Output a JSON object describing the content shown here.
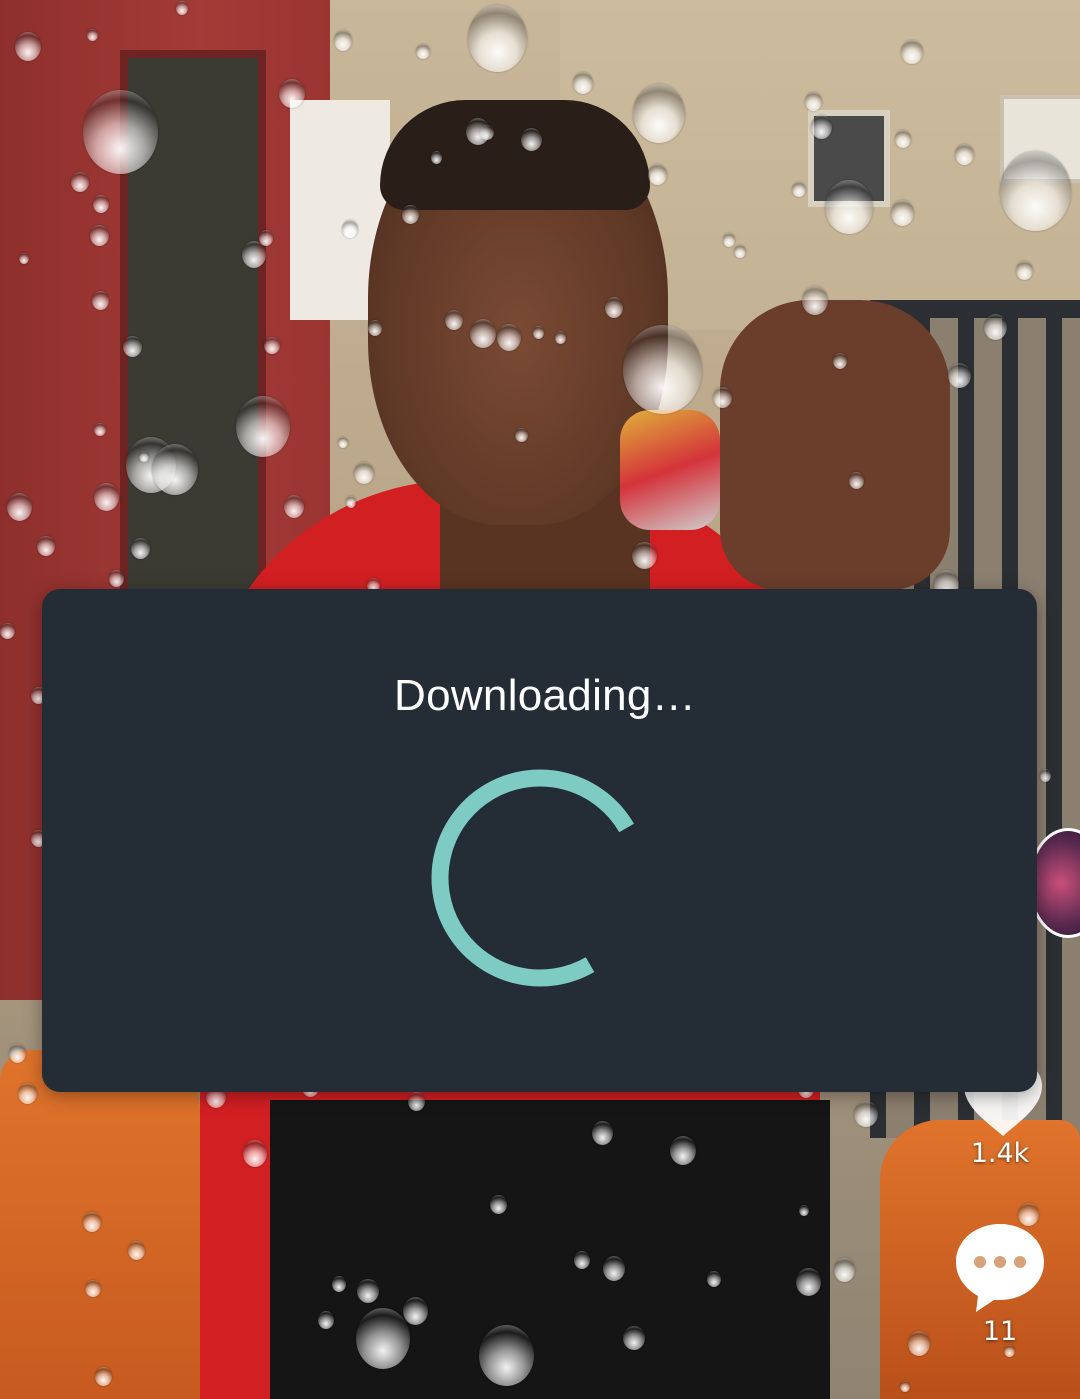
{
  "dialog": {
    "title": "Downloading…",
    "spinner_icon": "loading-spinner-icon",
    "spinner_color": "#7ecbc3",
    "background_color": "#242d35"
  },
  "right_rail": {
    "avatar_icon": "creator-avatar",
    "like_icon": "heart-icon",
    "like_count": "1.4k",
    "comment_icon": "comment-bubble-icon",
    "comment_count": "11"
  }
}
